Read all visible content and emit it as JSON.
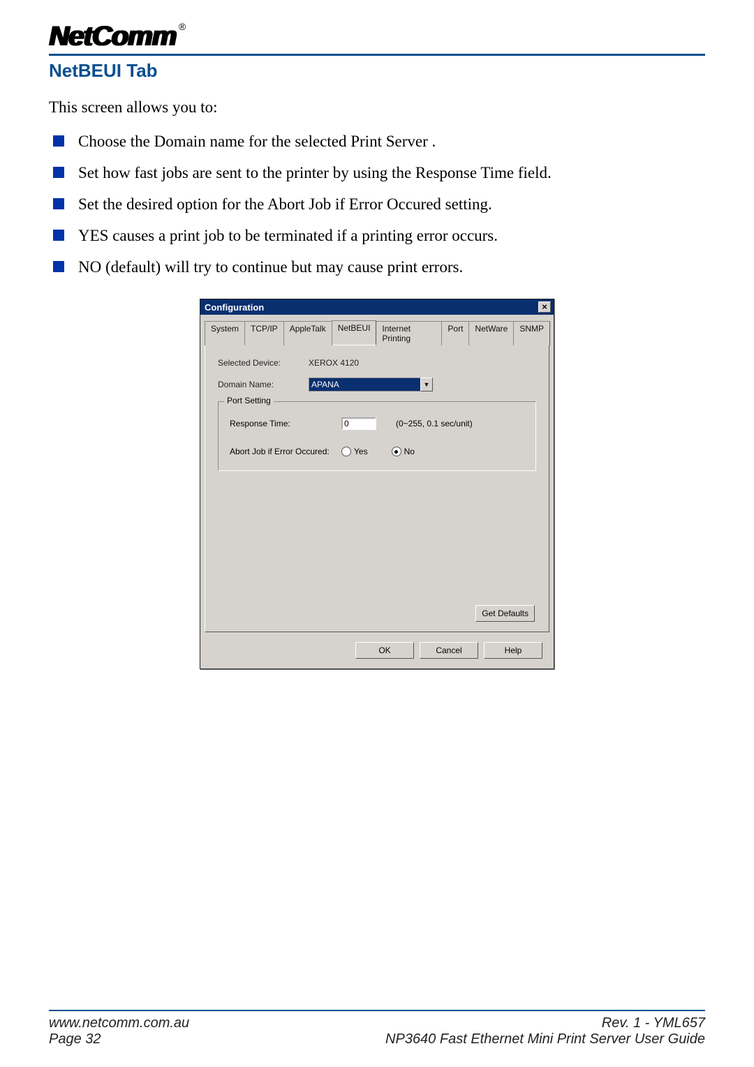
{
  "header": {
    "logo_text": "NetComm",
    "reg_mark": "®"
  },
  "section_title": "NetBEUI Tab",
  "intro": "This screen allows you to:",
  "bullets": [
    "Choose the Domain name for the selected Print Server .",
    "Set how fast jobs are sent to the printer by using the Response Time field.",
    "Set the desired option for the Abort Job if Error Occured setting.",
    "YES causes a print job to be terminated if a printing error occurs.",
    "NO (default) will try to continue but may cause print errors."
  ],
  "dialog": {
    "title": "Configuration",
    "close_glyph": "×",
    "tabs": [
      "System",
      "TCP/IP",
      "AppleTalk",
      "NetBEUI",
      "Internet Printing",
      "Port",
      "NetWare",
      "SNMP"
    ],
    "active_tab_index": 3,
    "selected_device_label": "Selected Device:",
    "selected_device_value": "XEROX 4120",
    "domain_name_label": "Domain Name:",
    "domain_name_value": "APANA",
    "dropdown_glyph": "▼",
    "port_setting_legend": "Port Setting",
    "response_time_label": "Response Time:",
    "response_time_value": "0",
    "response_time_hint": "(0~255, 0.1 sec/unit)",
    "abort_label": "Abort Job if Error Occured:",
    "abort_yes": "Yes",
    "abort_no": "No",
    "get_defaults": "Get Defaults",
    "ok": "OK",
    "cancel": "Cancel",
    "help": "Help"
  },
  "footer": {
    "url": "www.netcomm.com.au",
    "rev": "Rev. 1 - YML657",
    "page": "Page 32",
    "guide": "NP3640  Fast Ethernet Mini Print Server User Guide"
  }
}
